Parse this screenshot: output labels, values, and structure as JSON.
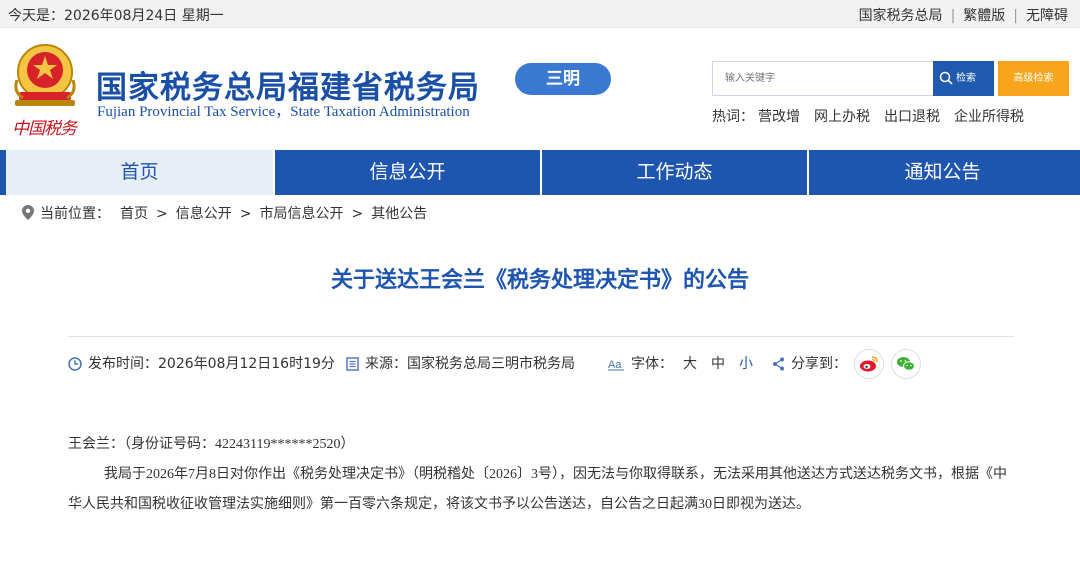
{
  "topbar": {
    "today": "今天是：2026年08月24日 星期一",
    "links": [
      "国家税务总局",
      "繁體版",
      "无障碍"
    ]
  },
  "header": {
    "signature": "中国税务",
    "title": "国家税务总局福建省税务局",
    "subtitle": "Fujian Provincial Tax Service，State Taxation Administration",
    "city": "三明",
    "search_placeholder": "输入关键字",
    "search_label": "检索",
    "advanced_label": "高级检索",
    "hot_label": "热词：",
    "hot_words": [
      "营改增",
      "网上办税",
      "出口退税",
      "企业所得税"
    ]
  },
  "nav": {
    "items": [
      "首页",
      "信息公开",
      "工作动态",
      "通知公告"
    ],
    "active": "首页"
  },
  "breadcrumb": {
    "label": "当前位置：",
    "items": [
      "首页",
      "信息公开",
      "市局信息公开",
      "其他公告"
    ]
  },
  "article": {
    "title": "关于送达王会兰《税务处理决定书》的公告",
    "publish_label": "发布时间：",
    "publish_time": "2026年08月12日16时19分",
    "source_label": "来源：",
    "source": "国家税务总局三明市税务局",
    "font_label": "字体：",
    "font_sizes": [
      "大",
      "中",
      "小"
    ],
    "share_label": "分享到：",
    "recipient": "王会兰：（身份证号码：42243119******2520）",
    "body": "我局于2026年7月8日对你作出《税务处理决定书》（明税稽处〔2026〕3号），因无法与你取得联系，无法采用其他送达方式送达税务文书，根据《中华人民共和国税收征收管理法实施细则》第一百零六条规定，将该文书予以公告送达，自公告之日起满30日即视为送达。"
  },
  "colors": {
    "brand_blue": "#1e55ae",
    "city_badge": "#3a79d1",
    "advanced_orange": "#f8a51b",
    "seal_red": "#c8141e"
  }
}
